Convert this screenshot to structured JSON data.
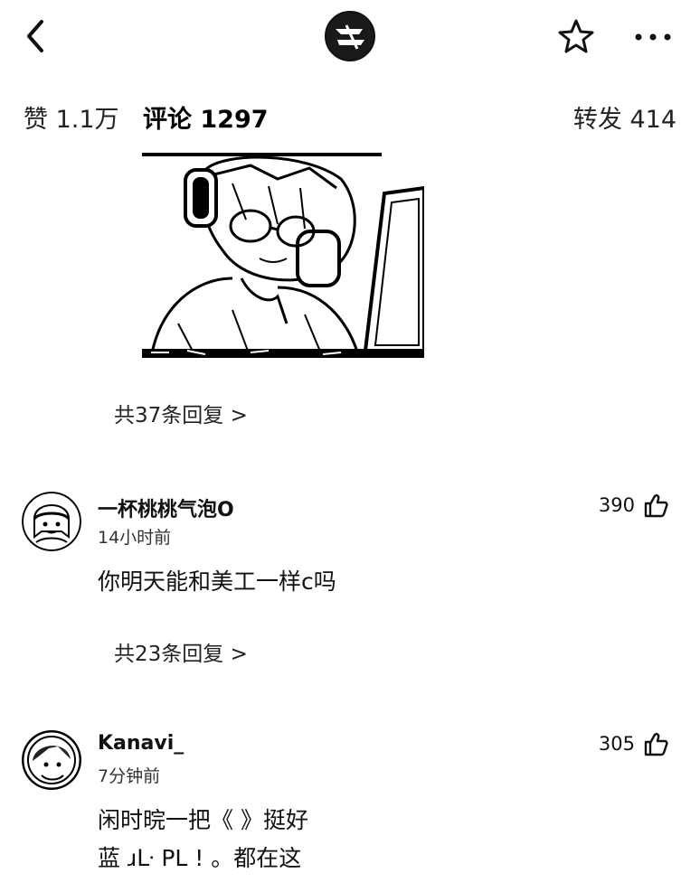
{
  "header": {
    "back_icon": "chevron-left-icon",
    "logo_icon": "brand-logo-icon",
    "favorite_icon": "star-outline-icon",
    "more_icon": "more-horizontal-icon"
  },
  "stats": {
    "likes": "赞 1.1万",
    "comments": "评论 1297",
    "shares": "转发 414"
  },
  "thread_top": {
    "image_icon": "comic-image",
    "replies_label": "共37条回复 >"
  },
  "comments": [
    {
      "username": "一杯桃桃气泡O",
      "time": "14小时前",
      "likes": "390",
      "like_icon": "thumbs-up-icon",
      "text": "你明天能和美工一样c吗",
      "replies_label": "共23条回复 >"
    },
    {
      "username": "Kanavi_",
      "time": "7分钟前",
      "likes": "305",
      "like_icon": "thumbs-up-icon",
      "text_line1": "闲时晥一把《            》挺好",
      "text_line2": "蓝 ɹᒷ PL ! 。都在这"
    }
  ]
}
